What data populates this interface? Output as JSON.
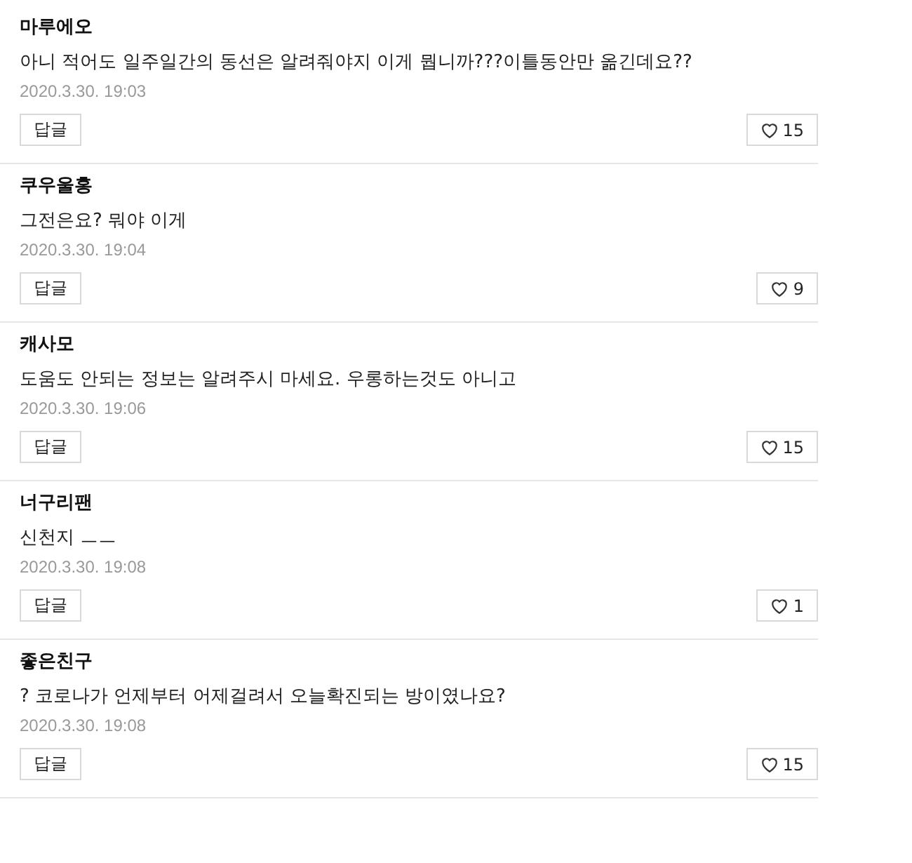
{
  "comments": [
    {
      "author": "마루에오",
      "text": "아니 적어도 일주일간의 동선은 알려줘야지 이게 뭡니까???이틀동안만 옮긴데요??",
      "date": "2020.3.30. 19:03",
      "reply": "답글",
      "likes": "15"
    },
    {
      "author": "쿠우울홍",
      "text": "그전은요? 뭐야 이게",
      "date": "2020.3.30. 19:04",
      "reply": "답글",
      "likes": "9"
    },
    {
      "author": "캐사모",
      "text": "도움도 안되는 정보는 알려주시 마세요. 우롱하는것도 아니고",
      "date": "2020.3.30. 19:06",
      "reply": "답글",
      "likes": "15"
    },
    {
      "author": "너구리팬",
      "text": "신천지 ㅡㅡ",
      "date": "2020.3.30. 19:08",
      "reply": "답글",
      "likes": "1"
    },
    {
      "author": "좋은친구",
      "text": "? 코로나가 언제부터 어제걸려서 오늘확진되는 방이였나요?",
      "date": "2020.3.30. 19:08",
      "reply": "답글",
      "likes": "15"
    }
  ]
}
